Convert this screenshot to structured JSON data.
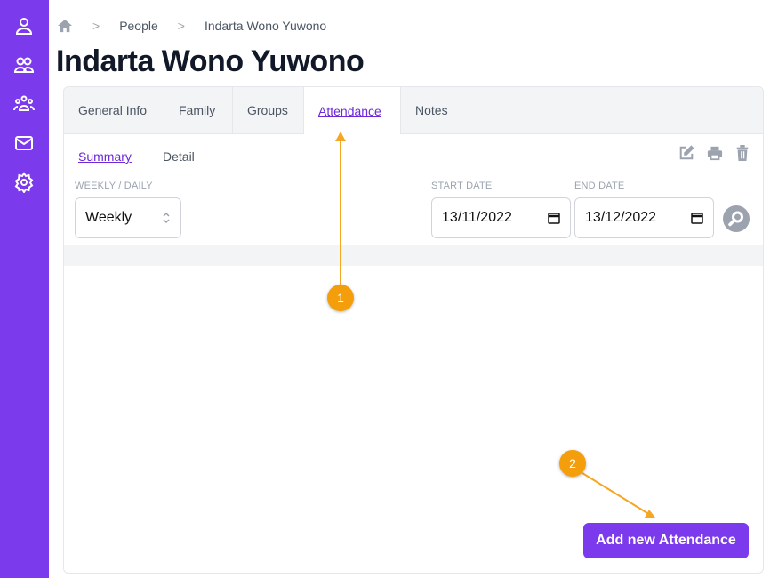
{
  "sidebar": {
    "items": [
      {
        "icon": "user-icon"
      },
      {
        "icon": "users-icon"
      },
      {
        "icon": "groups-icon"
      },
      {
        "icon": "mail-icon"
      },
      {
        "icon": "settings-icon"
      }
    ],
    "color": "#7c3aed"
  },
  "breadcrumb": {
    "items": [
      "People",
      "Indarta Wono Yuwono"
    ]
  },
  "page_title": "Indarta Wono Yuwono",
  "tabs": [
    {
      "label": "General Info"
    },
    {
      "label": "Family"
    },
    {
      "label": "Groups"
    },
    {
      "label": "Attendance",
      "active": true
    },
    {
      "label": "Notes"
    }
  ],
  "subtabs": [
    {
      "label": "Summary",
      "active": true
    },
    {
      "label": "Detail"
    }
  ],
  "filters": {
    "mode_label": "WEEKLY / DAILY",
    "mode_value": "Weekly",
    "start_label": "START DATE",
    "start_value": "13/11/2022",
    "end_label": "END DATE",
    "end_value": "13/12/2022"
  },
  "add_button": "Add new Attendance",
  "annotations": [
    "1",
    "2"
  ],
  "accent": "#7c3aed",
  "annotation_color": "#f5a623"
}
